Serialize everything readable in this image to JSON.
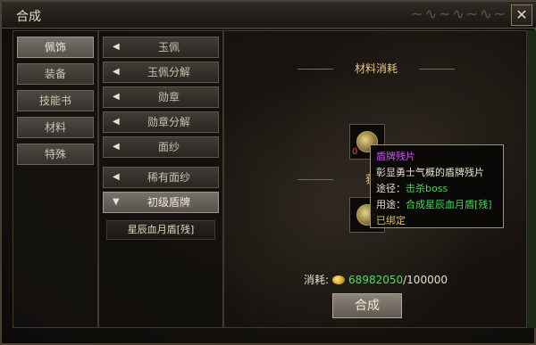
{
  "window": {
    "title": "合成"
  },
  "categories": [
    {
      "label": "佩饰",
      "active": true
    },
    {
      "label": "装备",
      "active": false
    },
    {
      "label": "技能书",
      "active": false
    },
    {
      "label": "材料",
      "active": false
    },
    {
      "label": "特殊",
      "active": false
    }
  ],
  "subcategories": [
    {
      "label": "玉佩",
      "expanded": false
    },
    {
      "label": "玉佩分解",
      "expanded": false
    },
    {
      "label": "勋章",
      "expanded": false
    },
    {
      "label": "勋章分解",
      "expanded": false
    },
    {
      "label": "面纱",
      "expanded": false
    },
    {
      "label": "稀有面纱",
      "expanded": false
    },
    {
      "label": "初级盾牌",
      "expanded": true
    }
  ],
  "recipes": [
    {
      "label": "星辰血月盾[残]"
    }
  ],
  "main": {
    "materials_title": "材料消耗",
    "result_title": "获得",
    "material_count": "0",
    "cost_label": "消耗:",
    "cost_have": "68982050",
    "cost_sep": "/",
    "cost_need": "100000",
    "craft_button": "合成"
  },
  "tooltip": {
    "name": "盾牌残片",
    "desc": "彰显勇士气概的盾牌残片",
    "source_label": "途径：",
    "source_value": "击杀boss",
    "use_label": "用途：",
    "use_value": "合成星辰血月盾[残]",
    "bound": "已绑定"
  },
  "icons": {
    "close": "close-icon",
    "coin": "gold-coin-icon",
    "arrow_collapsed": "arrow-left-icon",
    "arrow_expanded": "arrow-down-icon"
  },
  "colors": {
    "accent_gold": "#e8c982",
    "tooltip_name": "#d44cff",
    "green": "#3ddc4f",
    "bound": "#e5c14b"
  }
}
